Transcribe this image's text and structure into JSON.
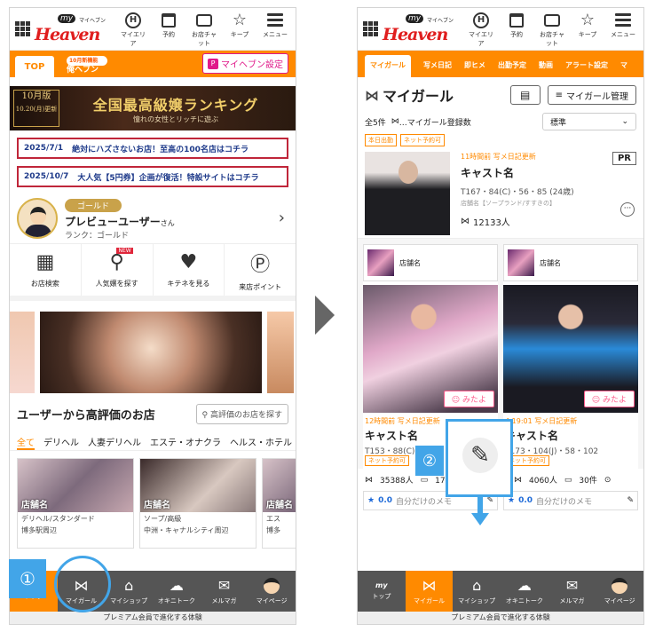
{
  "header": {
    "logo_my": "my",
    "logo_kana": "マイヘブン",
    "logo_text": "Heaven",
    "nav": [
      {
        "label": "マイエリア",
        "icon": "area-h-icon"
      },
      {
        "label": "予約",
        "icon": "calendar-icon"
      },
      {
        "label": "お店チャット",
        "icon": "chat-icon"
      },
      {
        "label": "キープ",
        "icon": "star-icon"
      },
      {
        "label": "メニュー",
        "icon": "menu-icon"
      }
    ]
  },
  "left": {
    "tab_top": "TOP",
    "tab_ore_badge": "10月新機能",
    "tab_ore": "俺ヘブン",
    "setting_label": "マイヘブン設定",
    "banner": {
      "edition": "10月版",
      "edition_date": "10.20(月)更新",
      "title": "全国最高級嬢ランキング",
      "sub": "憧れの女性とリッチに遊ぶ"
    },
    "news": [
      {
        "date": "2025/7/1",
        "text": "絶対にハズさないお店！至高の100名店はコチラ"
      },
      {
        "date": "2025/10/7",
        "text": "大人気【5円券】企画が復活！特設サイトはコチラ"
      }
    ],
    "user": {
      "rank_badge": "ゴールド",
      "name": "プレビューユーザー",
      "honorific": "さん",
      "rank": "ランク：ゴールド"
    },
    "quick_nav": [
      {
        "label": "お店検索",
        "icon": "shop-search-icon"
      },
      {
        "label": "人気嬢を探す",
        "icon": "popular-search-icon",
        "badge": "NEW"
      },
      {
        "label": "キテネを見る",
        "icon": "heart-icon"
      },
      {
        "label": "来店ポイント",
        "icon": "point-icon"
      }
    ],
    "section_title": "ユーザーから高評価のお店",
    "search_btn": "高評価のお店を探す",
    "cat_tabs": [
      "全て",
      "デリヘル",
      "人妻デリヘル",
      "エステ・オナクラ",
      "ヘルス・ホテル"
    ],
    "shops": [
      {
        "name": "店舗名",
        "genre": "デリヘル/スタンダード",
        "area": "博多駅周辺"
      },
      {
        "name": "店舗名",
        "genre": "ソープ/高級",
        "area": "中洲・キャナルシティ周辺"
      },
      {
        "name": "店舗名",
        "genre": "エス",
        "area": "博多"
      }
    ]
  },
  "right": {
    "tabs": [
      "マイガール",
      "写メ日記",
      "即ヒメ",
      "出勤予定",
      "動画",
      "アラート設定",
      "マ"
    ],
    "title": "マイガール",
    "manage_btn": "マイガール管理",
    "count": "全5件",
    "count_legend": "…マイガール登録数",
    "sort": "標準",
    "chips": [
      "本日出勤",
      "ネット予約可"
    ],
    "pr": "PR",
    "featured": {
      "updated": "11時間前 写メ日記更新",
      "name": "キャスト名",
      "meta": "T167・84(C)・56・85 (24歳)",
      "shop": "店舗名【ソープランド/すすきの】",
      "fans": "12133人"
    },
    "girls": [
      {
        "shop": "店舗名",
        "mitayo": "みたよ",
        "updated": "12時間前 写メ日記更新",
        "name": "キャスト名",
        "meta": "T153・88(C)・",
        "chip": "ネット予約可",
        "fans": "35388人",
        "comments": "172件",
        "rating": "0.0",
        "memo": "自分だけのメモ"
      },
      {
        "shop": "店舗名",
        "mitayo": "みたよ",
        "updated": "4 19:01 写メ日記更新",
        "name": "キャスト名",
        "meta": "T173・104(J)・58・102",
        "chip": "ネット予約可",
        "fans": "4060人",
        "comments": "30件",
        "rating": "0.0",
        "memo": "自分だけのメモ"
      }
    ]
  },
  "tabbar": [
    {
      "label": "トップ",
      "icon": "my-heaven-icon"
    },
    {
      "label": "マイガール",
      "icon": "ribbon-icon"
    },
    {
      "label": "マイショップ",
      "icon": "shop-icon"
    },
    {
      "label": "オキニトーク",
      "icon": "talk-icon"
    },
    {
      "label": "メルマガ",
      "icon": "mail-icon"
    },
    {
      "label": "マイページ",
      "icon": "avatar-icon"
    }
  ],
  "premium": "プレミアム会員で進化する体験",
  "markers": {
    "step1": "①",
    "step2": "②"
  },
  "colors": {
    "accent": "#ff8a00",
    "callout": "#42a5e8",
    "pink": "#e0198a"
  }
}
